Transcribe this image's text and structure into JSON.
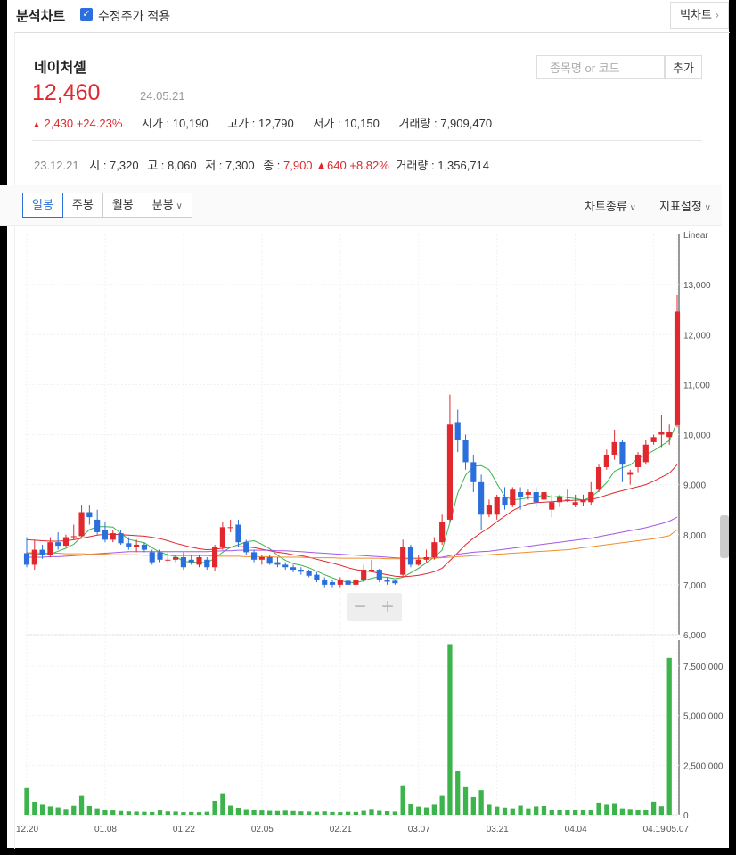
{
  "header": {
    "title": "분석차트",
    "adjusted_label": "수정주가 적용",
    "adjusted_checked": true,
    "big_chart_label": "빅차트"
  },
  "stock": {
    "name": "네이처셀",
    "price": "12,460",
    "date": "24.05.21",
    "change_arrow": "▲",
    "change": "2,430",
    "change_pct": "+24.23%",
    "open_label": "시가",
    "open": "10,190",
    "high_label": "고가",
    "high": "12,790",
    "low_label": "저가",
    "low": "10,150",
    "volume_label": "거래량",
    "volume": "7,909,470"
  },
  "search": {
    "placeholder": "종목명 or 코드",
    "add_label": "추가"
  },
  "hover_info": {
    "date": "23.12.21",
    "open_label": "시",
    "open": "7,320",
    "high_label": "고",
    "high": "8,060",
    "low_label": "저",
    "low": "7,300",
    "close_label": "종",
    "close": "7,900",
    "change_arrow": "▲",
    "change": "640",
    "change_pct": "+8.82%",
    "volume_label": "거래량",
    "volume": "1,356,714"
  },
  "tabs": [
    {
      "label": "일봉",
      "active": true
    },
    {
      "label": "주봉",
      "active": false
    },
    {
      "label": "월봉",
      "active": false
    },
    {
      "label": "분봉",
      "active": false
    }
  ],
  "menu": {
    "chart_type": "차트종류",
    "indicator": "지표설정"
  },
  "colors": {
    "up": "#e0282e",
    "down": "#2a6fdb",
    "ma5": "#3cb44b",
    "ma20": "#e0282e",
    "ma60": "#a259e6",
    "ma120": "#f08c2e",
    "volume": "#3cb44b",
    "accent": "#2a6fdb"
  },
  "chart_data": {
    "type": "candlestick",
    "scale": "Linear",
    "x_tick_labels": [
      "12.20",
      "01.08",
      "01.22",
      "02.05",
      "02.21",
      "03.07",
      "03.21",
      "04.04",
      "04.19",
      "05.07"
    ],
    "price_ticks": [
      "6,000",
      "7,000",
      "8,000",
      "9,000",
      "10,000",
      "11,000",
      "12,000",
      "13,000"
    ],
    "volume_ticks": [
      "0",
      "2,500,000",
      "5,000,000",
      "7,500,000"
    ],
    "ylim": [
      6000,
      14000
    ],
    "volume_ylim": [
      0,
      8800000
    ],
    "candles": [
      [
        7630,
        7950,
        7350,
        7400
      ],
      [
        7400,
        7900,
        7300,
        7700
      ],
      [
        7700,
        7800,
        7520,
        7600
      ],
      [
        7600,
        7950,
        7550,
        7850
      ],
      [
        7850,
        8050,
        7700,
        7780
      ],
      [
        7780,
        8000,
        7750,
        7950
      ],
      [
        7950,
        8200,
        7900,
        7970
      ],
      [
        7970,
        8600,
        7950,
        8450
      ],
      [
        8450,
        8600,
        8200,
        8350
      ],
      [
        8300,
        8500,
        8000,
        8050
      ],
      [
        8100,
        8250,
        7850,
        7900
      ],
      [
        7900,
        8100,
        7850,
        8030
      ],
      [
        8030,
        8100,
        7800,
        7830
      ],
      [
        7830,
        7950,
        7700,
        7750
      ],
      [
        7750,
        7900,
        7650,
        7800
      ],
      [
        7800,
        7850,
        7650,
        7700
      ],
      [
        7650,
        7700,
        7400,
        7450
      ],
      [
        7650,
        7700,
        7450,
        7500
      ],
      [
        7500,
        7650,
        7450,
        7500
      ],
      [
        7500,
        7600,
        7450,
        7550
      ],
      [
        7550,
        7650,
        7300,
        7350
      ],
      [
        7500,
        7600,
        7400,
        7450
      ],
      [
        7400,
        7600,
        7350,
        7550
      ],
      [
        7500,
        7550,
        7300,
        7350
      ],
      [
        7350,
        7800,
        7280,
        7750
      ],
      [
        7750,
        8250,
        7700,
        8150
      ],
      [
        8150,
        8300,
        8050,
        8150
      ],
      [
        8200,
        8300,
        7750,
        7850
      ],
      [
        7850,
        7900,
        7600,
        7650
      ],
      [
        7650,
        7700,
        7450,
        7500
      ],
      [
        7500,
        7600,
        7400,
        7550
      ],
      [
        7550,
        7600,
        7400,
        7420
      ],
      [
        7450,
        7550,
        7350,
        7400
      ],
      [
        7400,
        7450,
        7300,
        7350
      ],
      [
        7350,
        7400,
        7250,
        7300
      ],
      [
        7300,
        7350,
        7200,
        7260
      ],
      [
        7280,
        7300,
        7150,
        7180
      ],
      [
        7200,
        7250,
        7050,
        7100
      ],
      [
        7100,
        7150,
        6950,
        7000
      ],
      [
        7050,
        7100,
        6950,
        7000
      ],
      [
        7000,
        7150,
        6950,
        7100
      ],
      [
        7080,
        7100,
        6980,
        7000
      ],
      [
        7000,
        7150,
        6950,
        7100
      ],
      [
        7100,
        7400,
        7050,
        7300
      ],
      [
        7280,
        7500,
        7250,
        7300
      ],
      [
        7300,
        7320,
        7050,
        7100
      ],
      [
        7100,
        7150,
        7000,
        7060
      ],
      [
        7080,
        7100,
        7000,
        7030
      ],
      [
        7200,
        7900,
        7150,
        7750
      ],
      [
        7750,
        7800,
        7350,
        7400
      ],
      [
        7400,
        7600,
        7380,
        7500
      ],
      [
        7500,
        7700,
        7450,
        7550
      ],
      [
        7550,
        7950,
        7500,
        7850
      ],
      [
        7850,
        8400,
        7800,
        8250
      ],
      [
        8300,
        10800,
        8250,
        10200
      ],
      [
        10250,
        10500,
        9650,
        9900
      ],
      [
        9900,
        10000,
        9300,
        9450
      ],
      [
        9450,
        9600,
        8850,
        9050
      ],
      [
        9050,
        9200,
        8100,
        8400
      ],
      [
        8400,
        8700,
        8350,
        8600
      ],
      [
        8400,
        8800,
        8300,
        8750
      ],
      [
        8750,
        8950,
        8500,
        8600
      ],
      [
        8600,
        8950,
        8550,
        8900
      ],
      [
        8850,
        8950,
        8500,
        8750
      ],
      [
        8800,
        8900,
        8700,
        8850
      ],
      [
        8850,
        8950,
        8550,
        8650
      ],
      [
        8700,
        8900,
        8600,
        8850
      ],
      [
        8500,
        8800,
        8350,
        8650
      ],
      [
        8650,
        8800,
        8550,
        8750
      ],
      [
        8700,
        8900,
        8650,
        8700
      ],
      [
        8600,
        8800,
        8550,
        8650
      ],
      [
        8650,
        8800,
        8580,
        8700
      ],
      [
        8650,
        9050,
        8600,
        8850
      ],
      [
        8900,
        9400,
        8850,
        9350
      ],
      [
        9350,
        9700,
        9300,
        9600
      ],
      [
        9600,
        10100,
        9500,
        9850
      ],
      [
        9850,
        9900,
        9050,
        9400
      ],
      [
        9200,
        9300,
        9000,
        9250
      ],
      [
        9350,
        9650,
        9250,
        9600
      ],
      [
        9450,
        9900,
        9400,
        9800
      ],
      [
        9850,
        10000,
        9800,
        9950
      ],
      [
        10000,
        10400,
        9750,
        10050
      ],
      [
        9950,
        10200,
        9800,
        10050
      ],
      [
        10190,
        12790,
        10150,
        12460
      ]
    ],
    "volumes": [
      1356714,
      650000,
      520000,
      430000,
      380000,
      300000,
      460000,
      960000,
      450000,
      330000,
      260000,
      220000,
      190000,
      170000,
      160000,
      150000,
      140000,
      220000,
      170000,
      160000,
      130000,
      140000,
      130000,
      150000,
      720000,
      1050000,
      470000,
      360000,
      290000,
      240000,
      220000,
      200000,
      190000,
      210000,
      190000,
      170000,
      160000,
      150000,
      170000,
      140000,
      130000,
      150000,
      140000,
      200000,
      300000,
      200000,
      180000,
      160000,
      1450000,
      540000,
      420000,
      380000,
      520000,
      960000,
      8600000,
      2200000,
      1400000,
      900000,
      1250000,
      520000,
      420000,
      370000,
      330000,
      470000,
      330000,
      430000,
      450000,
      270000,
      230000,
      230000,
      240000,
      260000,
      260000,
      590000,
      520000,
      560000,
      330000,
      300000,
      230000,
      240000,
      680000,
      440000,
      7909470
    ],
    "moving_averages": [
      {
        "name": "MA5",
        "color": "#3cb44b",
        "values": [
          7630,
          7620,
          7600,
          7610,
          7670,
          7730,
          7810,
          7960,
          8100,
          8160,
          8160,
          8150,
          8030,
          7910,
          7870,
          7840,
          7740,
          7650,
          7600,
          7560,
          7470,
          7450,
          7450,
          7440,
          7530,
          7650,
          7750,
          7800,
          7860,
          7880,
          7810,
          7720,
          7590,
          7490,
          7420,
          7390,
          7340,
          7270,
          7200,
          7140,
          7080,
          7050,
          7040,
          7080,
          7130,
          7160,
          7150,
          7120,
          7150,
          7240,
          7330,
          7440,
          7550,
          7690,
          8240,
          8830,
          9190,
          9370,
          9380,
          9300,
          9020,
          8760,
          8700,
          8710,
          8740,
          8750,
          8800,
          8750,
          8770,
          8740,
          8720,
          8690,
          8750,
          8880,
          9040,
          9270,
          9340,
          9390,
          9530,
          9600,
          9680,
          9780,
          9880,
          10260
        ]
      },
      {
        "name": "MA20",
        "color": "#e0282e",
        "values": [
          7900,
          7890,
          7880,
          7870,
          7870,
          7880,
          7900,
          7930,
          7960,
          7990,
          8010,
          8010,
          8000,
          7990,
          7980,
          7970,
          7950,
          7920,
          7880,
          7830,
          7790,
          7750,
          7720,
          7700,
          7710,
          7730,
          7750,
          7760,
          7760,
          7740,
          7710,
          7680,
          7650,
          7630,
          7600,
          7580,
          7550,
          7510,
          7470,
          7430,
          7390,
          7340,
          7300,
          7280,
          7260,
          7230,
          7200,
          7170,
          7160,
          7170,
          7190,
          7220,
          7260,
          7330,
          7480,
          7640,
          7800,
          7930,
          8040,
          8140,
          8260,
          8370,
          8480,
          8560,
          8620,
          8640,
          8650,
          8660,
          8670,
          8680,
          8690,
          8690,
          8700,
          8740,
          8790,
          8840,
          8880,
          8920,
          8960,
          9000,
          9070,
          9150,
          9230,
          9400
        ]
      },
      {
        "name": "MA60",
        "color": "#a259e6",
        "values": [
          7550,
          7550,
          7550,
          7560,
          7560,
          7570,
          7580,
          7590,
          7610,
          7620,
          7630,
          7640,
          7650,
          7660,
          7660,
          7660,
          7660,
          7660,
          7660,
          7660,
          7660,
          7660,
          7660,
          7660,
          7670,
          7680,
          7680,
          7690,
          7690,
          7690,
          7690,
          7690,
          7680,
          7680,
          7670,
          7660,
          7650,
          7640,
          7630,
          7620,
          7610,
          7600,
          7590,
          7580,
          7570,
          7560,
          7550,
          7540,
          7530,
          7530,
          7530,
          7530,
          7540,
          7550,
          7580,
          7610,
          7630,
          7650,
          7660,
          7670,
          7690,
          7710,
          7730,
          7750,
          7770,
          7790,
          7810,
          7830,
          7850,
          7870,
          7890,
          7910,
          7930,
          7960,
          7990,
          8020,
          8050,
          8080,
          8110,
          8140,
          8180,
          8220,
          8270,
          8350
        ]
      },
      {
        "name": "MA120",
        "color": "#f08c2e",
        "values": [
          7640,
          7640,
          7630,
          7630,
          7630,
          7620,
          7620,
          7620,
          7610,
          7610,
          7610,
          7600,
          7600,
          7600,
          7600,
          7590,
          7590,
          7590,
          7590,
          7580,
          7580,
          7580,
          7580,
          7580,
          7570,
          7570,
          7570,
          7570,
          7560,
          7560,
          7560,
          7560,
          7550,
          7550,
          7550,
          7550,
          7540,
          7540,
          7540,
          7540,
          7530,
          7530,
          7530,
          7530,
          7530,
          7530,
          7520,
          7520,
          7520,
          7520,
          7520,
          7530,
          7530,
          7540,
          7550,
          7560,
          7570,
          7580,
          7590,
          7600,
          7610,
          7620,
          7630,
          7640,
          7650,
          7660,
          7670,
          7680,
          7690,
          7700,
          7720,
          7740,
          7760,
          7780,
          7800,
          7820,
          7840,
          7860,
          7880,
          7900,
          7920,
          7950,
          7980,
          8100
        ]
      }
    ]
  }
}
